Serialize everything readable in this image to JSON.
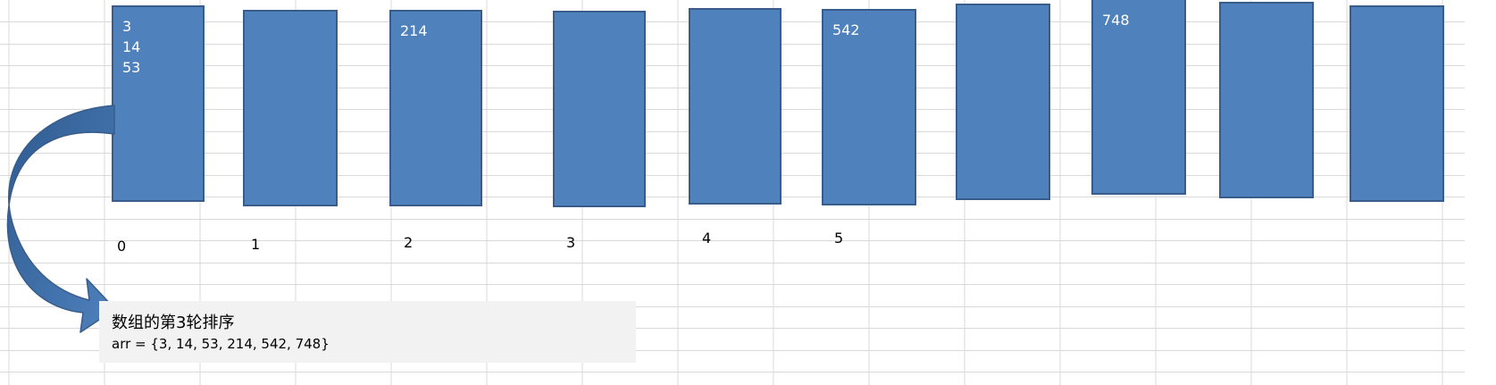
{
  "buckets": [
    {
      "index": "0",
      "values": [
        "3",
        "14",
        "53"
      ]
    },
    {
      "index": "1",
      "values": []
    },
    {
      "index": "2",
      "values": [
        "214"
      ]
    },
    {
      "index": "3",
      "values": []
    },
    {
      "index": "4",
      "values": []
    },
    {
      "index": "5",
      "values": [
        "542"
      ]
    },
    {
      "index": "",
      "values": []
    },
    {
      "index": "",
      "values": [
        "748"
      ]
    },
    {
      "index": "",
      "values": []
    },
    {
      "index": "",
      "values": []
    }
  ],
  "caption": {
    "title": "数组的第3轮排序",
    "array_text": "arr = {3, 14, 53, 214, 542, 748}"
  },
  "colors": {
    "bucket_fill": "#4f81bd",
    "bucket_border": "#385d8a",
    "caption_bg": "#f2f2f2",
    "grid_line": "#d9d9d9"
  }
}
